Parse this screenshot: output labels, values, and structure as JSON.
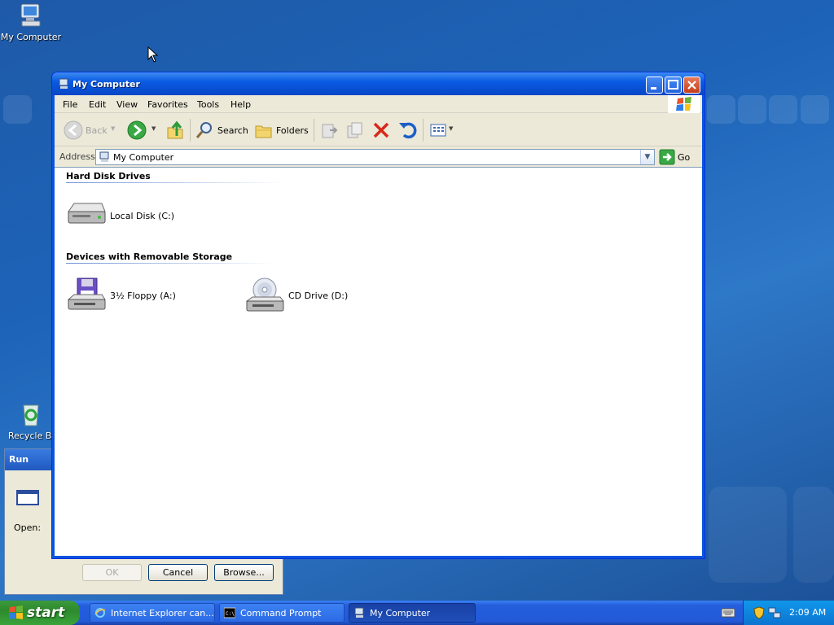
{
  "desktop": {
    "icons": [
      {
        "label": "My Computer"
      },
      {
        "label": "Recycle Bin"
      }
    ]
  },
  "run_dialog": {
    "title": "Run",
    "open_label": "Open:",
    "buttons": {
      "ok": "OK",
      "cancel": "Cancel",
      "browse": "Browse..."
    }
  },
  "window": {
    "title": "My Computer",
    "menu": [
      "File",
      "Edit",
      "View",
      "Favorites",
      "Tools",
      "Help"
    ],
    "toolbar": {
      "back": "Back",
      "search": "Search",
      "folders": "Folders"
    },
    "address": {
      "label": "Address",
      "value": "My Computer",
      "go": "Go"
    },
    "groups": [
      {
        "title": "Hard Disk Drives",
        "items": [
          {
            "label": "Local Disk (C:)",
            "icon": "hard-disk-icon"
          }
        ]
      },
      {
        "title": "Devices with Removable Storage",
        "items": [
          {
            "label": "3½ Floppy (A:)",
            "icon": "floppy-drive-icon"
          },
          {
            "label": "CD Drive (D:)",
            "icon": "cd-drive-icon"
          }
        ]
      }
    ]
  },
  "taskbar": {
    "start": "start",
    "tasks": [
      {
        "label": "Internet Explorer can..."
      },
      {
        "label": "Command Prompt"
      },
      {
        "label": "My Computer"
      }
    ],
    "clock": "2:09 AM"
  }
}
